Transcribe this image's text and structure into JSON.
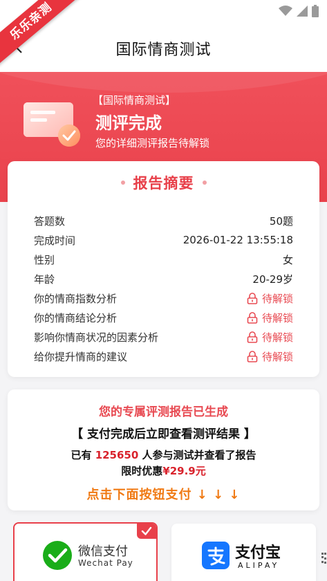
{
  "watermark": "乐乐亲测",
  "navbar": {
    "title": "国际情商测试"
  },
  "hero": {
    "tag": "【国际情商测试】",
    "title": "测评完成",
    "subtitle": "您的详细测评报告待解锁"
  },
  "summary": {
    "title": "报告摘要",
    "rows": [
      {
        "label": "答题数",
        "value": "50题"
      },
      {
        "label": "完成时间",
        "value": "2026-01-22 13:55:18"
      },
      {
        "label": "性别",
        "value": "女"
      },
      {
        "label": "年龄",
        "value": "20-29岁"
      },
      {
        "label": "你的情商指数分析",
        "value": "待解锁"
      },
      {
        "label": "你的情商结论分析",
        "value": "待解锁"
      },
      {
        "label": "影响你情商状况的因素分析",
        "value": "待解锁"
      },
      {
        "label": "给你提升情商的建议",
        "value": "待解锁"
      }
    ]
  },
  "promo": {
    "line1": "您的专属评测报告已生成",
    "line2": "【 支付完成后立即查看测评结果 】",
    "line3_prefix": "已有 ",
    "line3_count": "125650",
    "line3_suffix": " 人参与测试并查看了报告",
    "line4_prefix": "限时优惠",
    "line4_price": "¥29.9元",
    "line5": "点击下面按钮支付 ↓ ↓ ↓"
  },
  "payment": {
    "wechat": {
      "name": "微信支付",
      "name_en": "Wechat Pay",
      "selected": true
    },
    "alipay": {
      "name": "支付宝",
      "name_en": "ALIPAY"
    }
  },
  "colors": {
    "brand_red": "#e8404a",
    "hero_red": "#ee4a54",
    "price_red": "#d9232d",
    "orange": "#f07a14",
    "wechat_green": "#1aad19",
    "alipay_blue": "#1677ff"
  }
}
